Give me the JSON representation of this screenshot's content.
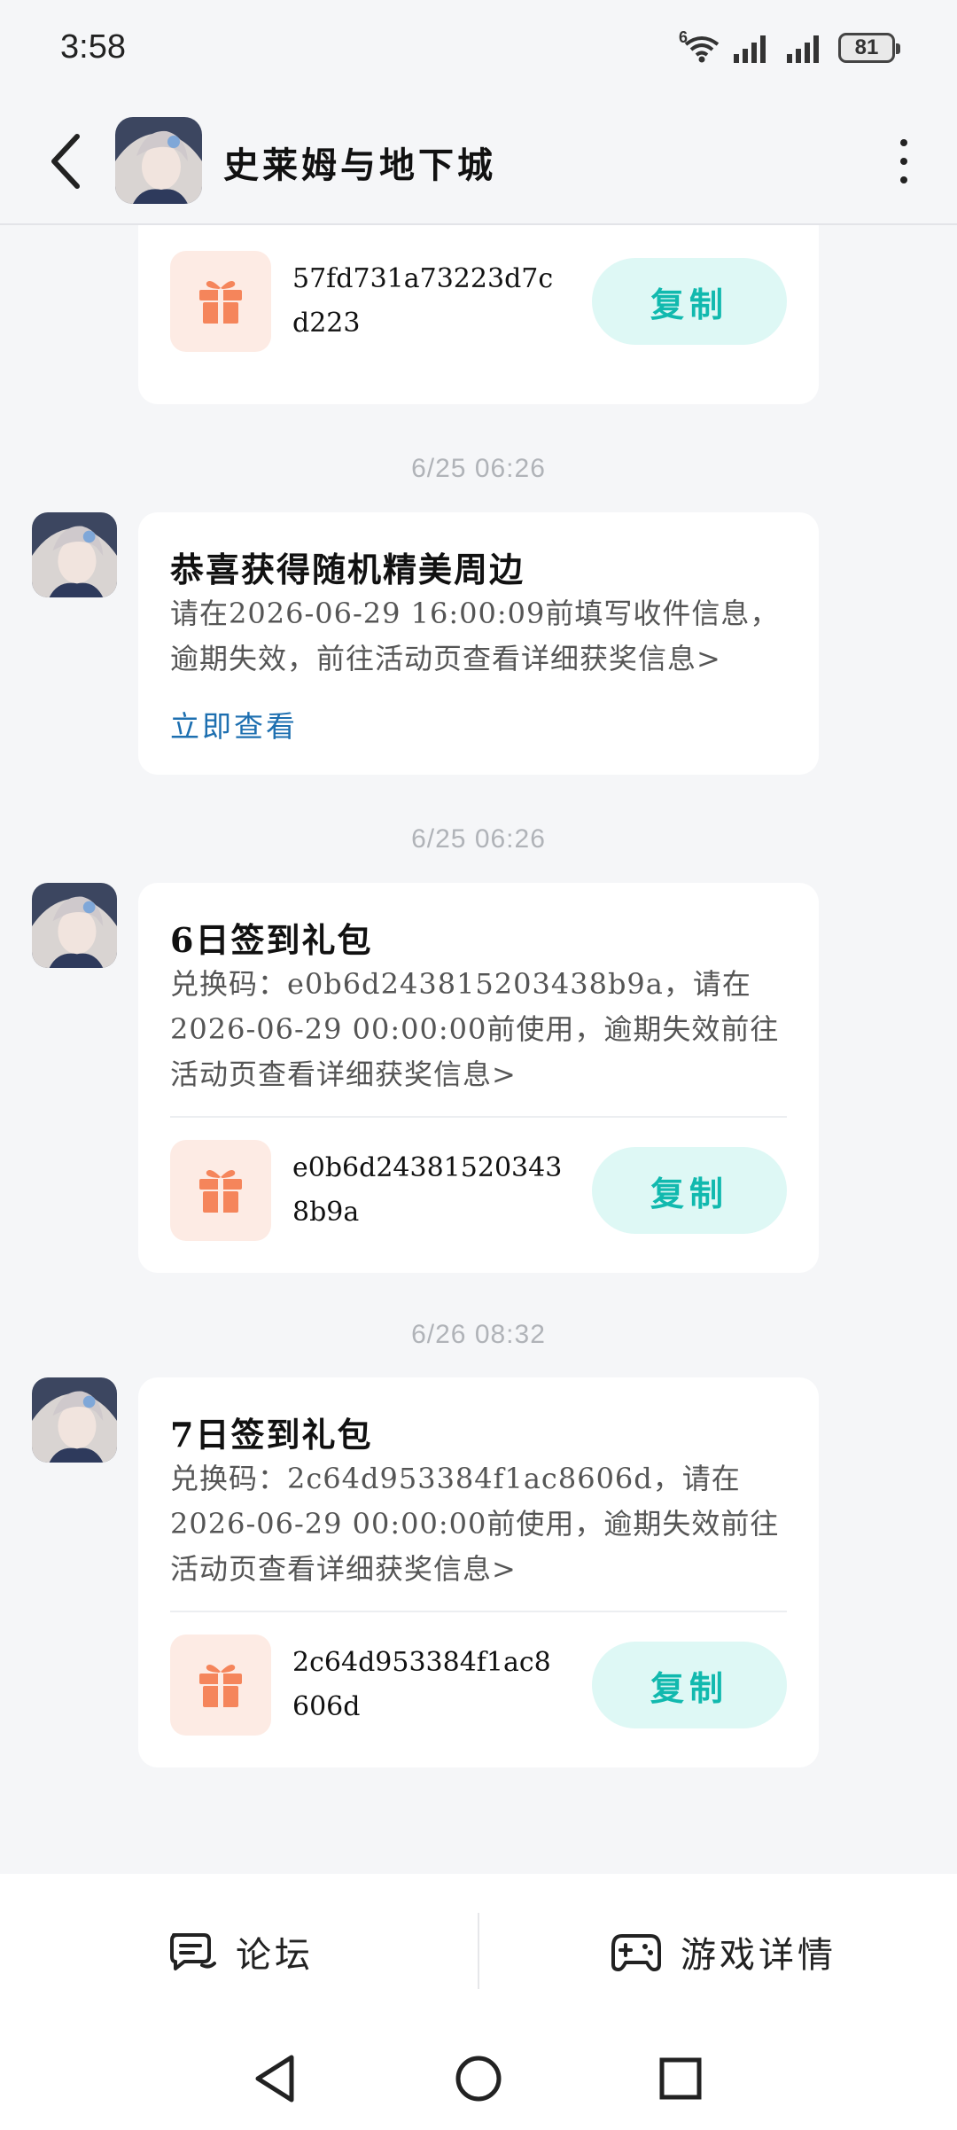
{
  "status_bar": {
    "time": "3:58",
    "battery": "81",
    "wifi_tag": "6"
  },
  "header": {
    "title": "史莱姆与地下城",
    "back_icon": "chevron-left-icon",
    "more_icon": "more-vertical-icon"
  },
  "messages": [
    {
      "type": "code",
      "code": "57fd731a73223d7cd223",
      "copy_label": "复制"
    },
    {
      "timestamp": "6/25  06:26",
      "title": "恭喜获得随机精美周边",
      "description": "请在2026-06-29 16:00:09前填写收件信息，逾期失效，前往活动页查看详细获奖信息>",
      "link": "立即查看"
    },
    {
      "timestamp": "6/25  06:26",
      "title": "6日签到礼包",
      "description": "兑换码：e0b6d243815203438b9a，请在2026-06-29 00:00:00前使用，逾期失效前往活动页查看详细获奖信息>",
      "code": "e0b6d243815203438b9a",
      "copy_label": "复制"
    },
    {
      "timestamp": "6/26  08:32",
      "title": "7日签到礼包",
      "description": "兑换码：2c64d953384f1ac8606d，请在2026-06-29 00:00:00前使用，逾期失效前往活动页查看详细获奖信息>",
      "code": "2c64d953384f1ac8606d",
      "copy_label": "复制"
    }
  ],
  "bottom_bar": {
    "forum_label": "论坛",
    "game_details_label": "游戏详情"
  },
  "colors": {
    "accent": "#11b9ae",
    "copy_bg": "#def8f5",
    "gift": "#f5855b",
    "gift_bg": "#fdebe4",
    "link": "#1d6fb0"
  }
}
